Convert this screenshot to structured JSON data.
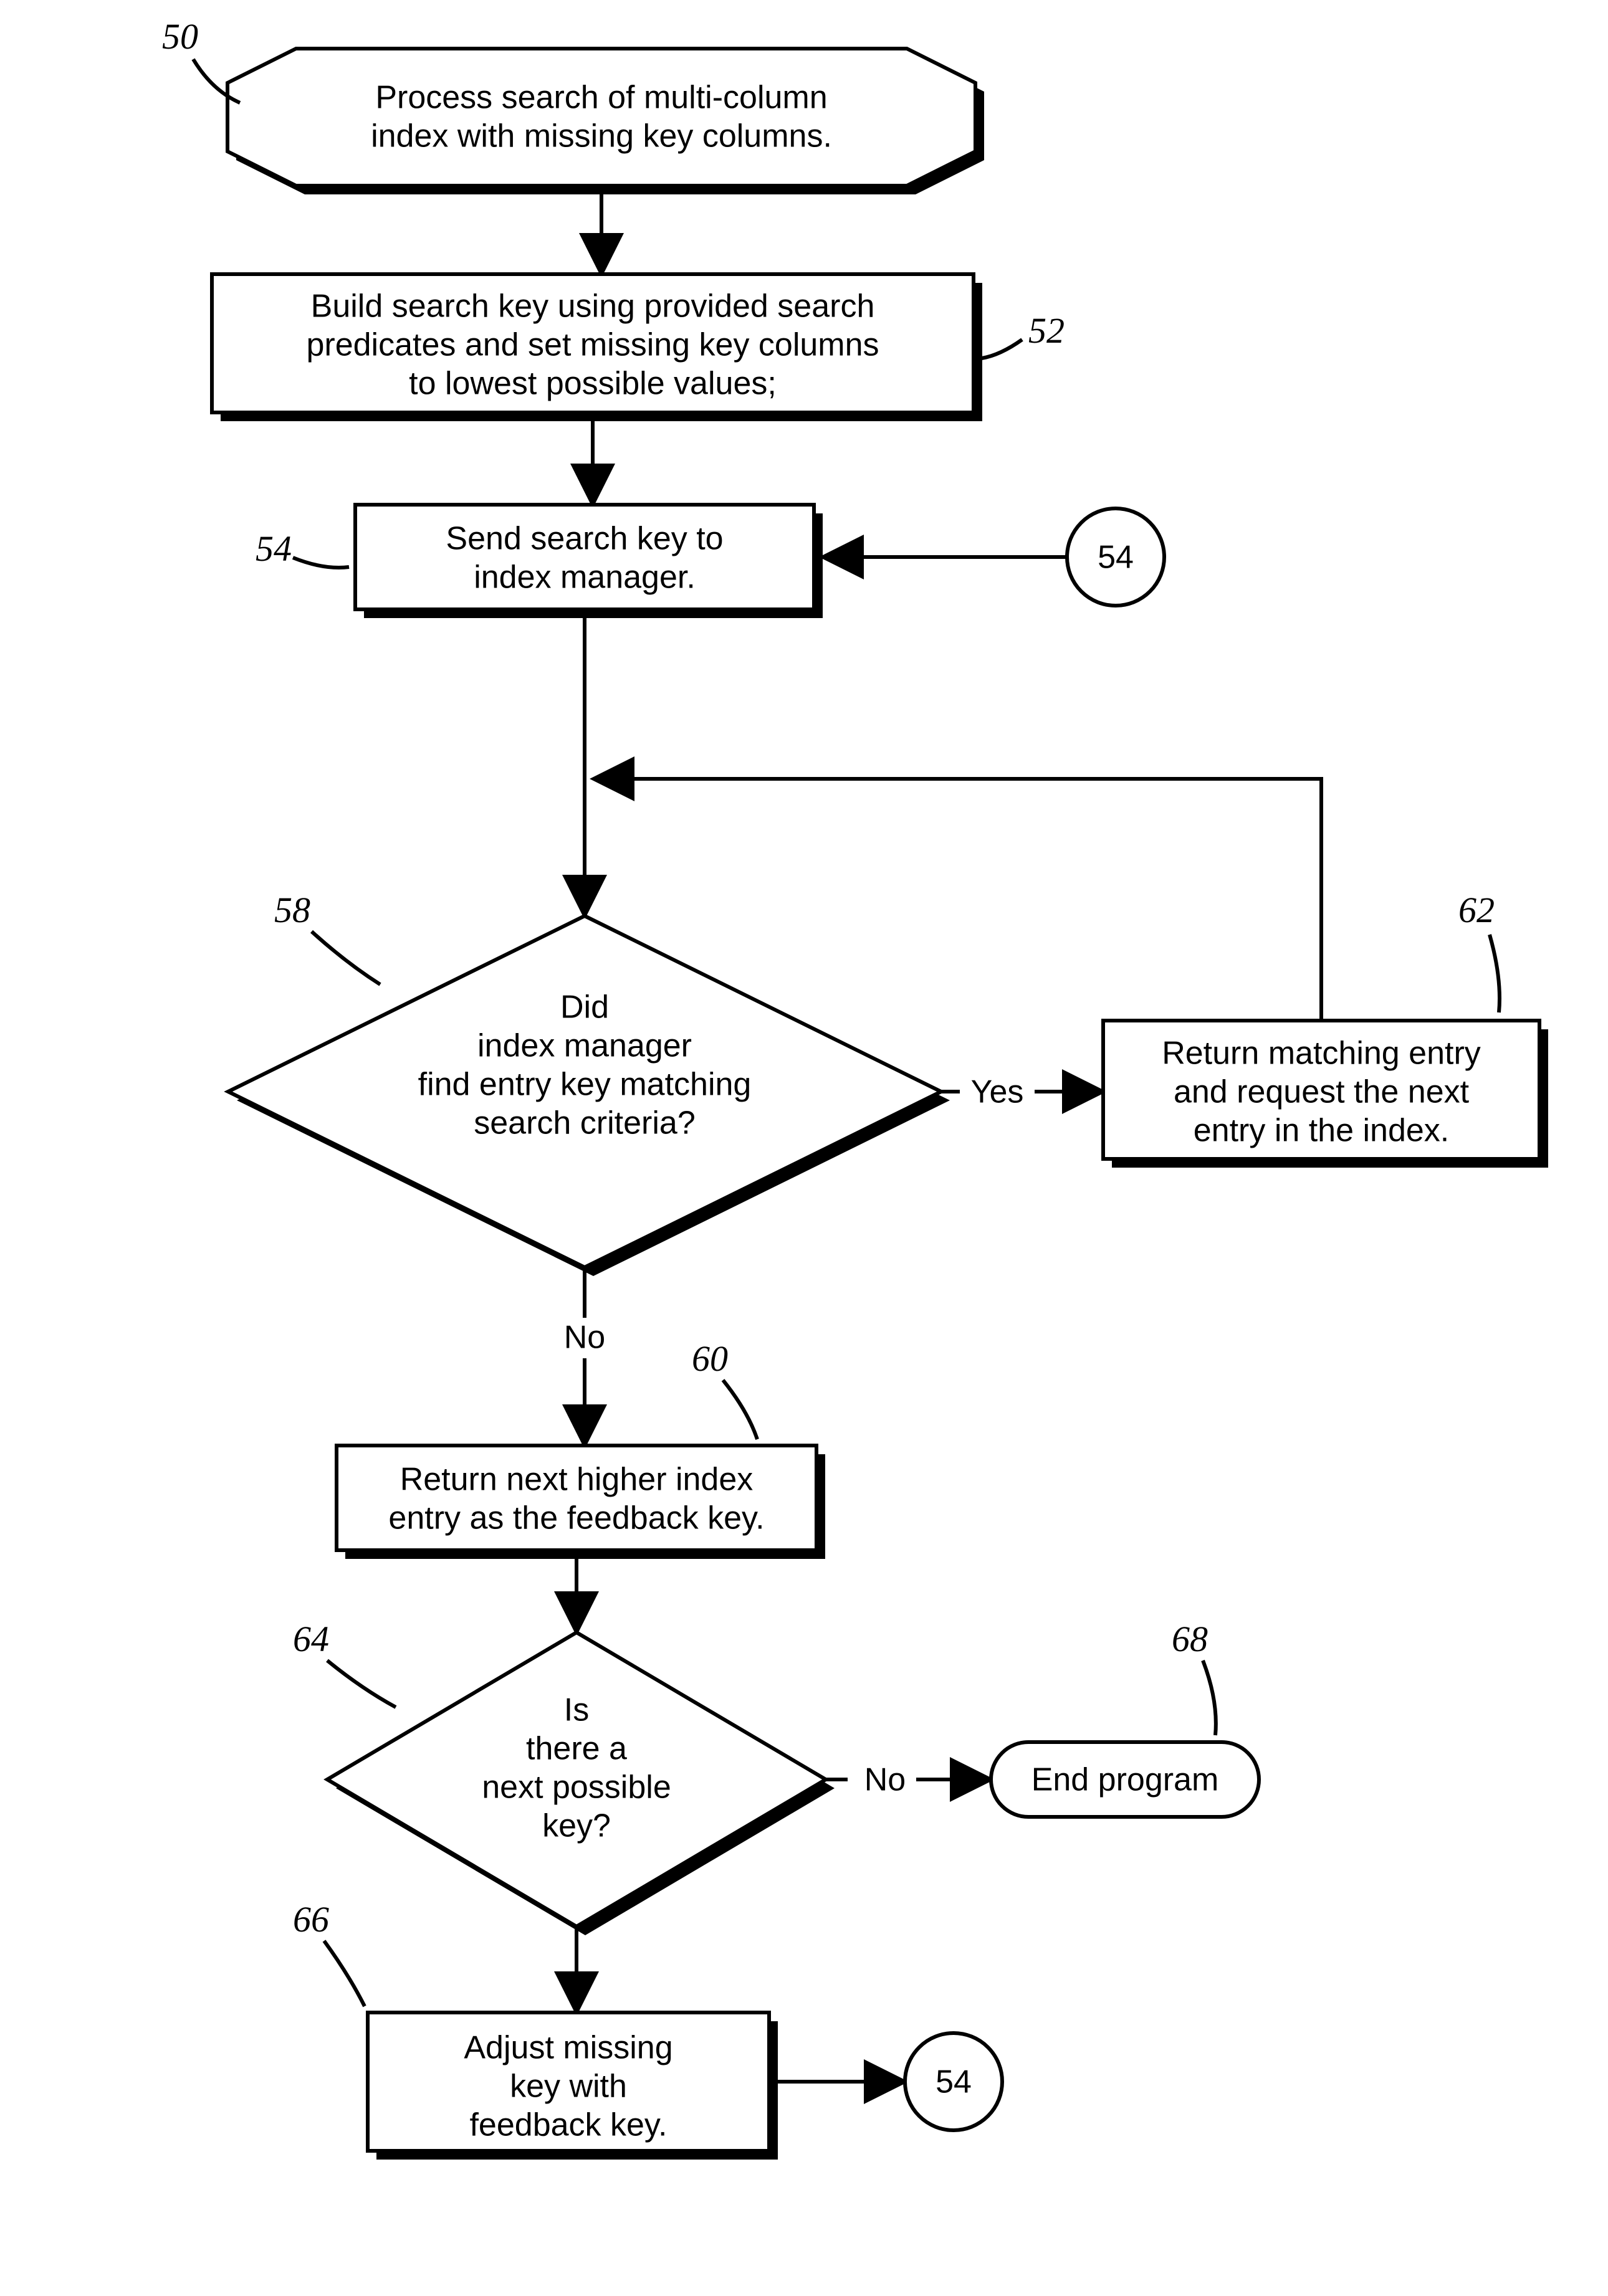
{
  "diagram": {
    "type": "flowchart",
    "nodes": {
      "n50": {
        "ref": "50",
        "shape": "hexagon-horizontal",
        "lines": [
          "Process search of multi-column",
          "index with missing key columns."
        ]
      },
      "n52": {
        "ref": "52",
        "shape": "process",
        "lines": [
          "Build search key using provided search",
          "predicates and set missing key columns",
          "to lowest possible values;"
        ]
      },
      "n54": {
        "ref": "54",
        "shape": "process",
        "lines": [
          "Send search key to",
          "index manager."
        ]
      },
      "c54a": {
        "shape": "connector",
        "lines": [
          "54"
        ]
      },
      "n58": {
        "ref": "58",
        "shape": "decision",
        "lines": [
          "Did",
          "index manager",
          "find entry key matching",
          "search criteria?"
        ]
      },
      "n62": {
        "ref": "62",
        "shape": "process",
        "lines": [
          "Return matching entry",
          "and request the next",
          "entry in the index."
        ]
      },
      "n60": {
        "ref": "60",
        "shape": "process",
        "lines": [
          "Return next higher index",
          "entry as the feedback key."
        ]
      },
      "n64": {
        "ref": "64",
        "shape": "decision",
        "lines": [
          "Is",
          "there a",
          "next possible",
          "key?"
        ]
      },
      "n68": {
        "ref": "68",
        "shape": "terminator",
        "lines": [
          "End program"
        ]
      },
      "n66": {
        "ref": "66",
        "shape": "process",
        "lines": [
          "Adjust missing",
          "key with",
          "feedback key."
        ]
      },
      "c54b": {
        "shape": "connector",
        "lines": [
          "54"
        ]
      }
    },
    "edges": {
      "e58yes": "Yes",
      "e58no": "No",
      "e64no": "No"
    }
  }
}
